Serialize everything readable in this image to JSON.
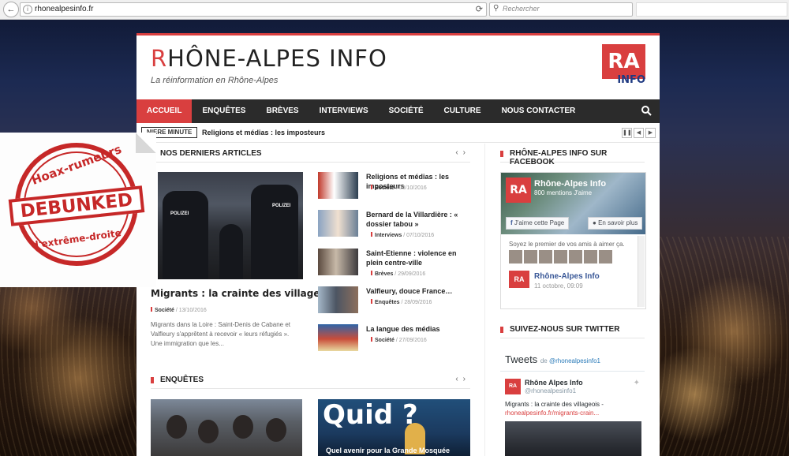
{
  "browser": {
    "url": "rhonealpesinfo.fr",
    "search_placeholder": "Rechercher"
  },
  "site": {
    "title_first": "R",
    "title_rest": "HÔNE-ALPES INFO",
    "tagline": "La réinformation en Rhône-Alpes",
    "logo_top": "RA",
    "logo_bottom": "INFO"
  },
  "menu": [
    {
      "label": "ACCUEIL",
      "active": true
    },
    {
      "label": "ENQUÊTES"
    },
    {
      "label": "BRÈVES"
    },
    {
      "label": "INTERVIEWS"
    },
    {
      "label": "SOCIÉTÉ"
    },
    {
      "label": "CULTURE"
    },
    {
      "label": "NOUS CONTACTER"
    }
  ],
  "ticker": {
    "label": "NIERE MINUTE",
    "text": "Religions et médias : les imposteurs"
  },
  "latest": {
    "heading": "NOS DERNIERS ARTICLES",
    "featured": {
      "title": "Migrants : la crainte des villageois",
      "category": "Société",
      "date": "13/10/2016",
      "excerpt": "Migrants dans la Loire : Saint-Denis de Cabane et Valfleury s'apprêtent à recevoir « leurs réfugiés ». Une immigration que les..."
    },
    "articles": [
      {
        "title": "Religions et médias : les imposteurs",
        "category": "Société",
        "date": "08/10/2016"
      },
      {
        "title": "Bernard de la Villardière : « dossier tabou »",
        "category": "Interviews",
        "date": "07/10/2016"
      },
      {
        "title": "Saint-Etienne : violence en plein centre-ville",
        "category": "Brèves",
        "date": "29/09/2016"
      },
      {
        "title": "Valfleury, douce France…",
        "category": "Enquêtes",
        "date": "28/09/2016"
      },
      {
        "title": "La langue des médias",
        "category": "Société",
        "date": "27/09/2016"
      }
    ]
  },
  "enquetes": {
    "heading": "ENQUÊTES",
    "quid_text": "Quid ?",
    "quid_sub": "Quel avenir pour la Grande Mosquée"
  },
  "facebook": {
    "heading": "RHÔNE-ALPES INFO SUR FACEBOOK",
    "page_name": "Rhône-Alpes Info",
    "likes": "800 mentions J'aime",
    "like_button": "J'aime cette Page",
    "more_button": "En savoir plus",
    "friends_text": "Soyez le premier de vos amis à aimer ça.",
    "post_name": "Rhône-Alpes Info",
    "post_date": "11 octobre, 09:09"
  },
  "twitter": {
    "heading": "SUIVEZ-NOUS SUR TWITTER",
    "title": "Tweets",
    "by": "de",
    "handle_link": "@rhonealpesinfo1",
    "name": "Rhône Alpes Info",
    "handle": "@rhonealpesinfo1",
    "text": "Migrants : la crainte des villageois -",
    "link": "rhonealpesinfo.fr/migrants-crain..."
  },
  "stamp": {
    "top": "Hoax-rumeurs",
    "middle": "DEBUNKED",
    "bottom": "d'extrême-droite"
  }
}
